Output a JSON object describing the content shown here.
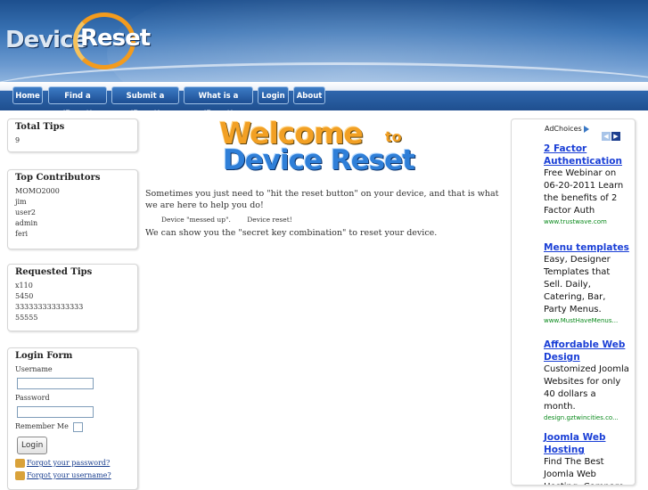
{
  "header": {
    "logo_device": "Device",
    "logo_reset": "Reset"
  },
  "nav": {
    "items": [
      {
        "label": "Home"
      },
      {
        "label": "Find a 'Reset'"
      },
      {
        "label": "Submit a 'Reset'"
      },
      {
        "label": "What is a 'Reset'"
      },
      {
        "label": "Login"
      },
      {
        "label": "About"
      }
    ]
  },
  "sidebar": {
    "total_tips": {
      "title": "Total Tips",
      "value": "9"
    },
    "top_contributors": {
      "title": "Top Contributors",
      "items": [
        "MOMO2000",
        "jim",
        "user2",
        "admin",
        "feri"
      ]
    },
    "requested_tips": {
      "title": "Requested Tips",
      "items": [
        "x110",
        "5450",
        "333333333333333",
        "55555"
      ]
    },
    "login": {
      "title": "Login Form",
      "username_label": "Username",
      "password_label": "Password",
      "remember_label": "Remember Me",
      "button_label": "Login",
      "forgot_password": "Forgot your password?",
      "forgot_username": "Forgot your username?"
    }
  },
  "main": {
    "welcome_line1": "Welcome",
    "welcome_to": "to",
    "welcome_line2": "Device Reset",
    "paragraph1": "Sometimes you just need to \"hit the reset button\" on your device, and that is what we are here to help you do!",
    "caption1": "Device \"messed up\".",
    "caption2": "Device reset!",
    "paragraph2": "We can show you the \"secret key combination\" to reset your device."
  },
  "ads": {
    "adchoices_label": "AdChoices",
    "items": [
      {
        "title": "2 Factor Authentication",
        "text": "Free Webinar on 06-20-2011 Learn the benefits of 2 Factor Auth",
        "url": "www.trustwave.com"
      },
      {
        "title": "Menu templates",
        "text": "Easy, Designer Templates that Sell. Daily, Catering, Bar, Party Menus.",
        "url": "www.MustHaveMenus..."
      },
      {
        "title": "Affordable Web Design",
        "text": "Customized Joomla Websites for only 40 dollars a month.",
        "url": "design.gztwincities.co..."
      },
      {
        "title": "Joomla Web Hosting",
        "text": "Find The Best Joomla Web Hosting. Compare",
        "url": ""
      }
    ]
  },
  "colors": {
    "nav_blue": "#1f4f8f",
    "accent_orange": "#f2a024",
    "accent_blue": "#2f7fd8",
    "ad_link": "#1a3fd6",
    "ad_url": "#0a8a1c"
  }
}
